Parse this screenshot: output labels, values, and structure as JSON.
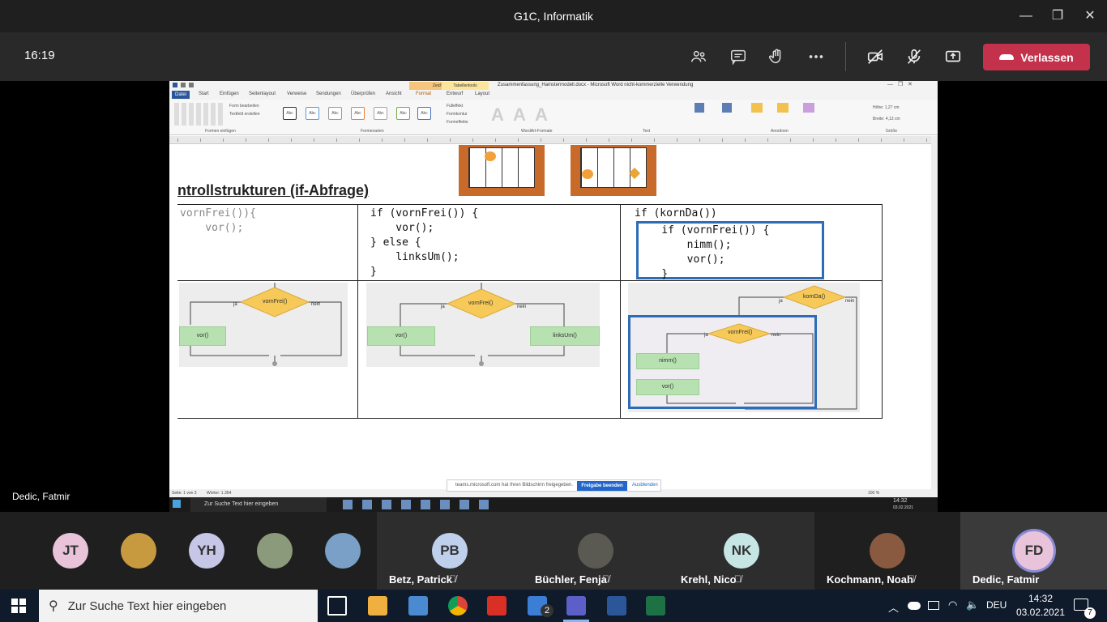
{
  "window": {
    "title": "G1C, Informatik",
    "controls": [
      "—",
      "❐",
      "✕"
    ]
  },
  "meeting": {
    "clock": "16:19",
    "leave_label": "Verlassen",
    "presenter": "Dedic, Fatmir"
  },
  "word": {
    "title": "Zusammenfassung_Hamstermodell.docx - Microsoft Word nicht-kommerzielle Verwendung",
    "context_tabs": [
      "Zeichentools",
      "Tabellentools"
    ],
    "tabs": [
      "Datei",
      "Start",
      "Einfügen",
      "Seitenlayout",
      "Verweise",
      "Sendungen",
      "Überprüfen",
      "Ansicht",
      "Format",
      "Entwurf",
      "Layout"
    ],
    "ribbon": {
      "form_edit": "Form bearbeiten",
      "textbox": "Textfeld erstellen",
      "group_insert": "Formen einfügen",
      "group_styles": "Formenarten",
      "style_sample": "Abc",
      "fill": "Fülleffekt",
      "outline": "Formkontur",
      "effects": "Formeffekte",
      "wordart_group": "WordArt-Formate",
      "text_group": "Text",
      "arrange_group": "Anordnen",
      "size_group": "Größe",
      "height": "Höhe: 1,27 cm",
      "width": "Breite: 4,13 cm"
    },
    "status": {
      "page": "Seite: 1 von 3",
      "words": "Wörter: 1.354",
      "zoom": "100 %"
    },
    "share_notice": {
      "text": "teams.microsoft.com hat Ihren Bildschirm freigegeben.",
      "stop": "Freigabe beenden",
      "hide": "Ausblenden"
    },
    "inner_taskbar": {
      "search": "Zur Suche Text hier eingeben",
      "time": "14:32",
      "date": "03.02.2021"
    }
  },
  "doc": {
    "heading": "ntrollstrukturen (if-Abfrage)",
    "code1": "vornFrei()){\n    vor();",
    "code2": "if (vornFrei()) {\n    vor();\n} else {\n    linksUm();\n}",
    "code3_outer": "if (kornDa())",
    "code3_inner": "    if (vornFrei()) {\n        nimm();\n        vor();\n    }",
    "flow": {
      "vornfrei": "vornFrei()",
      "kornda": "kornDa()",
      "ja": "ja",
      "nein": "nein",
      "vor": "vor()",
      "linksum": "linksUm()",
      "nimm": "nimm()"
    }
  },
  "participants": [
    {
      "initials": "JT",
      "name": "",
      "color": "#e8c3da"
    },
    {
      "initials": "",
      "name": "",
      "color": "#c89a40"
    },
    {
      "initials": "YH",
      "name": "",
      "color": "#c6c6e6"
    },
    {
      "initials": "",
      "name": "",
      "color": "#8a9a7a"
    },
    {
      "initials": "",
      "name": "",
      "color": "#7aa0c8"
    },
    {
      "initials": "PB",
      "name": "Betz, Patrick",
      "color": "#bfd0ec"
    },
    {
      "initials": "",
      "name": "Büchler, Fenja",
      "color": "#5a5a52"
    },
    {
      "initials": "NK",
      "name": "Krehl, Nico",
      "color": "#c6e6e6"
    },
    {
      "initials": "",
      "name": "Kochmann, Noah",
      "color": "#8a5a40"
    },
    {
      "initials": "FD",
      "name": "Dedic, Fatmir",
      "color": "#e8c3da"
    }
  ],
  "taskbar": {
    "search_placeholder": "Zur Suche Text hier eingeben",
    "mail_badge": "2",
    "lang": "DEU",
    "time": "14:32",
    "date": "03.02.2021",
    "notif_count": "7"
  },
  "colors": {
    "leave": "#c4314b",
    "teams_dark": "#292929",
    "selection_blue": "#2e6cb5",
    "flow_diamond": "#f6c958"
  }
}
